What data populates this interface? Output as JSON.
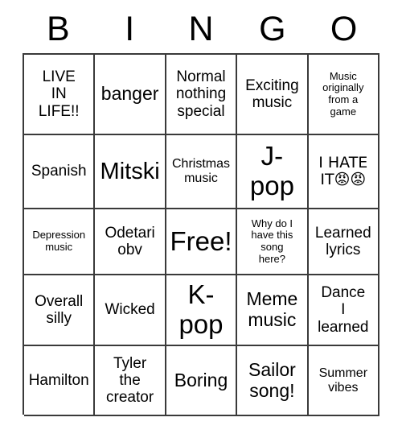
{
  "card": {
    "header_letters": [
      "B",
      "I",
      "N",
      "G",
      "O"
    ],
    "rows": [
      [
        {
          "text": "LIVE\nIN\nLIFE!!",
          "size": "m"
        },
        {
          "text": "banger",
          "size": "l"
        },
        {
          "text": "Normal\nnothing\nspecial",
          "size": "m"
        },
        {
          "text": "Exciting\nmusic",
          "size": "m"
        },
        {
          "text": "Music\noriginally\nfrom a\ngame",
          "size": "xs"
        }
      ],
      [
        {
          "text": "Spanish",
          "size": "m"
        },
        {
          "text": "Mitski",
          "size": "xl"
        },
        {
          "text": "Christmas\nmusic",
          "size": "s"
        },
        {
          "text": "J-\npop",
          "size": "xxl"
        },
        {
          "text": "I HATE\nIT😡😡",
          "size": "m"
        }
      ],
      [
        {
          "text": "Depression\nmusic",
          "size": "xs"
        },
        {
          "text": "Odetari\nobv",
          "size": "m"
        },
        {
          "text": "Free!",
          "size": "xxl"
        },
        {
          "text": "Why do I\nhave this\nsong\nhere?",
          "size": "xs"
        },
        {
          "text": "Learned\nlyrics",
          "size": "m"
        }
      ],
      [
        {
          "text": "Overall\nsilly",
          "size": "m"
        },
        {
          "text": "Wicked",
          "size": "m"
        },
        {
          "text": "K-\npop",
          "size": "xxl"
        },
        {
          "text": "Meme\nmusic",
          "size": "l"
        },
        {
          "text": "Dance\nI\nlearned",
          "size": "m"
        }
      ],
      [
        {
          "text": "Hamilton",
          "size": "m"
        },
        {
          "text": "Tyler\nthe\ncreator",
          "size": "m"
        },
        {
          "text": "Boring",
          "size": "l"
        },
        {
          "text": "Sailor\nsong!",
          "size": "l"
        },
        {
          "text": "Summer\nvibes",
          "size": "s"
        }
      ]
    ]
  },
  "colors": {
    "background": "#ffffff",
    "text": "#000000",
    "grid_line": "#3a3a3a"
  }
}
